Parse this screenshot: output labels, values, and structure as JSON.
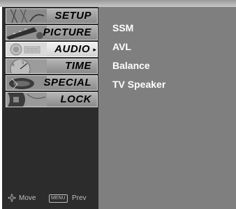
{
  "sidebar": {
    "items": [
      {
        "label": "SETUP",
        "icon": "satellite-dish-icon",
        "active": false
      },
      {
        "label": "PICTURE",
        "icon": "film-reel-icon",
        "active": false
      },
      {
        "label": "AUDIO",
        "icon": "speaker-icon",
        "active": true,
        "arrow": "▸"
      },
      {
        "label": "TIME",
        "icon": "clock-icon",
        "active": false
      },
      {
        "label": "SPECIAL",
        "icon": "special-icon",
        "active": false
      },
      {
        "label": "LOCK",
        "icon": "lock-icon",
        "active": false
      }
    ]
  },
  "content": {
    "items": [
      "SSM",
      "AVL",
      "Balance",
      "TV Speaker"
    ]
  },
  "footer": {
    "move_label": "Move",
    "menu_key": "MENU",
    "prev_label": "Prev"
  },
  "colors": {
    "sidebar_bg": "#2c2c2c",
    "content_bg": "#7f7f7f",
    "active_item_bg": "#e6e6e6",
    "item_bg": "#a0a0a0",
    "content_text": "#ffffff"
  }
}
